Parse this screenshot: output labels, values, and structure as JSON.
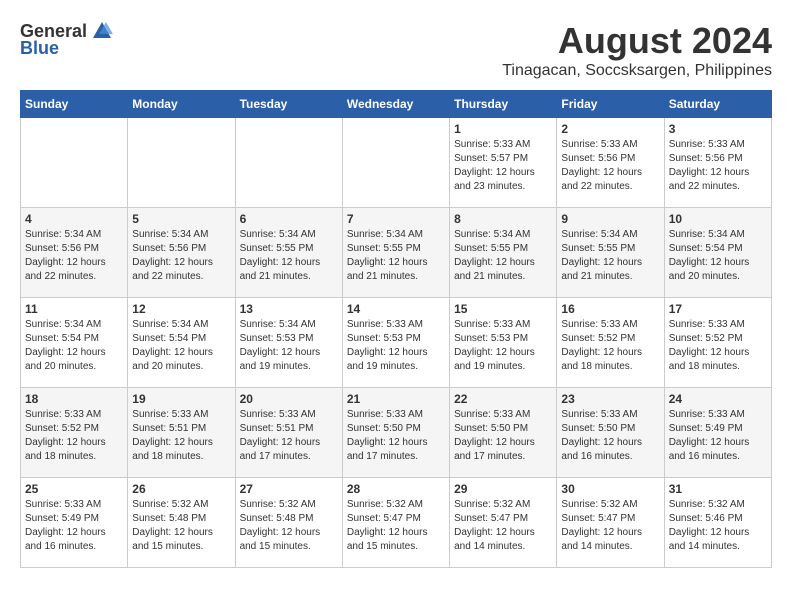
{
  "logo": {
    "general": "General",
    "blue": "Blue"
  },
  "title": "August 2024",
  "location": "Tinagacan, Soccsksargen, Philippines",
  "headers": [
    "Sunday",
    "Monday",
    "Tuesday",
    "Wednesday",
    "Thursday",
    "Friday",
    "Saturday"
  ],
  "weeks": [
    [
      {
        "day": "",
        "sunrise": "",
        "sunset": "",
        "daylight": ""
      },
      {
        "day": "",
        "sunrise": "",
        "sunset": "",
        "daylight": ""
      },
      {
        "day": "",
        "sunrise": "",
        "sunset": "",
        "daylight": ""
      },
      {
        "day": "",
        "sunrise": "",
        "sunset": "",
        "daylight": ""
      },
      {
        "day": "1",
        "sunrise": "Sunrise: 5:33 AM",
        "sunset": "Sunset: 5:57 PM",
        "daylight": "Daylight: 12 hours and 23 minutes."
      },
      {
        "day": "2",
        "sunrise": "Sunrise: 5:33 AM",
        "sunset": "Sunset: 5:56 PM",
        "daylight": "Daylight: 12 hours and 22 minutes."
      },
      {
        "day": "3",
        "sunrise": "Sunrise: 5:33 AM",
        "sunset": "Sunset: 5:56 PM",
        "daylight": "Daylight: 12 hours and 22 minutes."
      }
    ],
    [
      {
        "day": "4",
        "sunrise": "Sunrise: 5:34 AM",
        "sunset": "Sunset: 5:56 PM",
        "daylight": "Daylight: 12 hours and 22 minutes."
      },
      {
        "day": "5",
        "sunrise": "Sunrise: 5:34 AM",
        "sunset": "Sunset: 5:56 PM",
        "daylight": "Daylight: 12 hours and 22 minutes."
      },
      {
        "day": "6",
        "sunrise": "Sunrise: 5:34 AM",
        "sunset": "Sunset: 5:55 PM",
        "daylight": "Daylight: 12 hours and 21 minutes."
      },
      {
        "day": "7",
        "sunrise": "Sunrise: 5:34 AM",
        "sunset": "Sunset: 5:55 PM",
        "daylight": "Daylight: 12 hours and 21 minutes."
      },
      {
        "day": "8",
        "sunrise": "Sunrise: 5:34 AM",
        "sunset": "Sunset: 5:55 PM",
        "daylight": "Daylight: 12 hours and 21 minutes."
      },
      {
        "day": "9",
        "sunrise": "Sunrise: 5:34 AM",
        "sunset": "Sunset: 5:55 PM",
        "daylight": "Daylight: 12 hours and 21 minutes."
      },
      {
        "day": "10",
        "sunrise": "Sunrise: 5:34 AM",
        "sunset": "Sunset: 5:54 PM",
        "daylight": "Daylight: 12 hours and 20 minutes."
      }
    ],
    [
      {
        "day": "11",
        "sunrise": "Sunrise: 5:34 AM",
        "sunset": "Sunset: 5:54 PM",
        "daylight": "Daylight: 12 hours and 20 minutes."
      },
      {
        "day": "12",
        "sunrise": "Sunrise: 5:34 AM",
        "sunset": "Sunset: 5:54 PM",
        "daylight": "Daylight: 12 hours and 20 minutes."
      },
      {
        "day": "13",
        "sunrise": "Sunrise: 5:34 AM",
        "sunset": "Sunset: 5:53 PM",
        "daylight": "Daylight: 12 hours and 19 minutes."
      },
      {
        "day": "14",
        "sunrise": "Sunrise: 5:33 AM",
        "sunset": "Sunset: 5:53 PM",
        "daylight": "Daylight: 12 hours and 19 minutes."
      },
      {
        "day": "15",
        "sunrise": "Sunrise: 5:33 AM",
        "sunset": "Sunset: 5:53 PM",
        "daylight": "Daylight: 12 hours and 19 minutes."
      },
      {
        "day": "16",
        "sunrise": "Sunrise: 5:33 AM",
        "sunset": "Sunset: 5:52 PM",
        "daylight": "Daylight: 12 hours and 18 minutes."
      },
      {
        "day": "17",
        "sunrise": "Sunrise: 5:33 AM",
        "sunset": "Sunset: 5:52 PM",
        "daylight": "Daylight: 12 hours and 18 minutes."
      }
    ],
    [
      {
        "day": "18",
        "sunrise": "Sunrise: 5:33 AM",
        "sunset": "Sunset: 5:52 PM",
        "daylight": "Daylight: 12 hours and 18 minutes."
      },
      {
        "day": "19",
        "sunrise": "Sunrise: 5:33 AM",
        "sunset": "Sunset: 5:51 PM",
        "daylight": "Daylight: 12 hours and 18 minutes."
      },
      {
        "day": "20",
        "sunrise": "Sunrise: 5:33 AM",
        "sunset": "Sunset: 5:51 PM",
        "daylight": "Daylight: 12 hours and 17 minutes."
      },
      {
        "day": "21",
        "sunrise": "Sunrise: 5:33 AM",
        "sunset": "Sunset: 5:50 PM",
        "daylight": "Daylight: 12 hours and 17 minutes."
      },
      {
        "day": "22",
        "sunrise": "Sunrise: 5:33 AM",
        "sunset": "Sunset: 5:50 PM",
        "daylight": "Daylight: 12 hours and 17 minutes."
      },
      {
        "day": "23",
        "sunrise": "Sunrise: 5:33 AM",
        "sunset": "Sunset: 5:50 PM",
        "daylight": "Daylight: 12 hours and 16 minutes."
      },
      {
        "day": "24",
        "sunrise": "Sunrise: 5:33 AM",
        "sunset": "Sunset: 5:49 PM",
        "daylight": "Daylight: 12 hours and 16 minutes."
      }
    ],
    [
      {
        "day": "25",
        "sunrise": "Sunrise: 5:33 AM",
        "sunset": "Sunset: 5:49 PM",
        "daylight": "Daylight: 12 hours and 16 minutes."
      },
      {
        "day": "26",
        "sunrise": "Sunrise: 5:32 AM",
        "sunset": "Sunset: 5:48 PM",
        "daylight": "Daylight: 12 hours and 15 minutes."
      },
      {
        "day": "27",
        "sunrise": "Sunrise: 5:32 AM",
        "sunset": "Sunset: 5:48 PM",
        "daylight": "Daylight: 12 hours and 15 minutes."
      },
      {
        "day": "28",
        "sunrise": "Sunrise: 5:32 AM",
        "sunset": "Sunset: 5:47 PM",
        "daylight": "Daylight: 12 hours and 15 minutes."
      },
      {
        "day": "29",
        "sunrise": "Sunrise: 5:32 AM",
        "sunset": "Sunset: 5:47 PM",
        "daylight": "Daylight: 12 hours and 14 minutes."
      },
      {
        "day": "30",
        "sunrise": "Sunrise: 5:32 AM",
        "sunset": "Sunset: 5:47 PM",
        "daylight": "Daylight: 12 hours and 14 minutes."
      },
      {
        "day": "31",
        "sunrise": "Sunrise: 5:32 AM",
        "sunset": "Sunset: 5:46 PM",
        "daylight": "Daylight: 12 hours and 14 minutes."
      }
    ]
  ]
}
